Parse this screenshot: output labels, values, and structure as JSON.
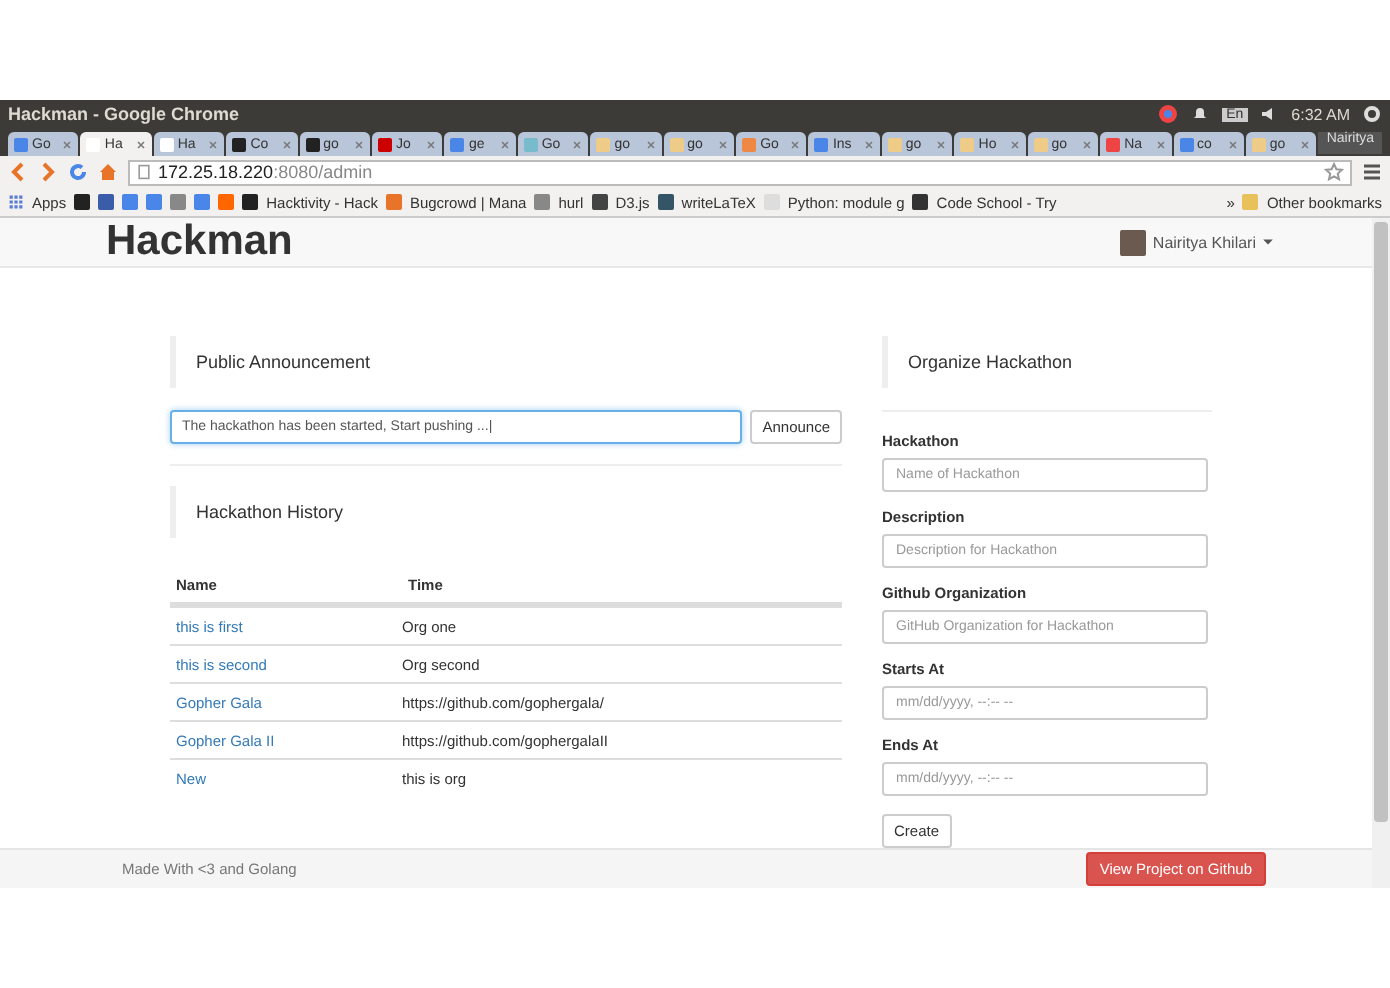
{
  "window": {
    "title": "Hackman - Google Chrome"
  },
  "system_tray": {
    "keyboard": "En",
    "time": "6:32 AM",
    "user": "Nairitya"
  },
  "tabs": [
    {
      "label": "Go",
      "selected": false
    },
    {
      "label": "Ha",
      "selected": true
    },
    {
      "label": "Ha",
      "selected": false
    },
    {
      "label": "Co",
      "selected": false
    },
    {
      "label": "go",
      "selected": false
    },
    {
      "label": "Jo",
      "selected": false
    },
    {
      "label": "ge",
      "selected": false
    },
    {
      "label": "Go",
      "selected": false
    },
    {
      "label": "go",
      "selected": false
    },
    {
      "label": "go",
      "selected": false
    },
    {
      "label": "Go",
      "selected": false
    },
    {
      "label": "Ins",
      "selected": false
    },
    {
      "label": "go",
      "selected": false
    },
    {
      "label": "Ho",
      "selected": false
    },
    {
      "label": "go",
      "selected": false
    },
    {
      "label": "Na",
      "selected": false
    },
    {
      "label": "co",
      "selected": false
    },
    {
      "label": "go",
      "selected": false
    }
  ],
  "address_bar": {
    "host": "172.25.18.220",
    "path": ":8080/admin"
  },
  "bookmarks": {
    "apps": "Apps",
    "items": [
      "Hacktivity - Hack",
      "Bugcrowd | Mana",
      "hurl",
      "D3.js",
      "writeLaTeX",
      "Python: module g",
      "Code School - Try"
    ],
    "more": "»",
    "other": "Other bookmarks"
  },
  "navbar": {
    "brand": "Hackman",
    "user": "Nairitya Khilari"
  },
  "announcement": {
    "title": "Public Announcement",
    "value": "The hackathon has been started, Start pushing ...|",
    "button": "Announce"
  },
  "history": {
    "title": "Hackathon History",
    "columns": [
      "Name",
      "Time"
    ],
    "rows": [
      [
        "this is first",
        "Org one"
      ],
      [
        "this is second",
        "Org second"
      ],
      [
        "Gopher Gala",
        "https://github.com/gophergala/"
      ],
      [
        "Gopher Gala II",
        "https://github.com/gophergalaII"
      ],
      [
        "New",
        "this is org"
      ]
    ]
  },
  "organize": {
    "title": "Organize Hackathon",
    "fields": [
      {
        "label": "Hackathon",
        "placeholder": "Name of Hackathon"
      },
      {
        "label": "Description",
        "placeholder": "Description for Hackathon"
      },
      {
        "label": "Github Organization",
        "placeholder": "GitHub Organization for Hackathon"
      },
      {
        "label": "Starts At",
        "placeholder": "mm/dd/yyyy, --:-- --"
      },
      {
        "label": "Ends At",
        "placeholder": "mm/dd/yyyy, --:-- --"
      }
    ],
    "button": "Create"
  },
  "footer": {
    "text": "Made With <3 and Golang",
    "button": "View Project on Github"
  }
}
